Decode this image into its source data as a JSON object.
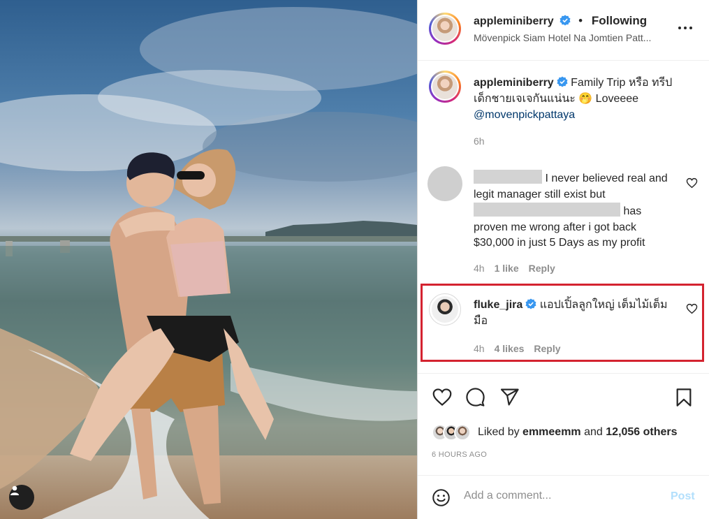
{
  "post": {
    "username": "appleminiberry",
    "follow_label": "Following",
    "location": "Movenpick Siam Hotel Na Jomtien Pattaya",
    "location_display": "Mövenpick Siam Hotel Na Jomtien Patt...",
    "caption_text": "Family Trip หรือ ทรีปเด็กชายเจเจกันแน่นะ 🤭 Loveeee",
    "caption_mention": "@movenpickpattaya",
    "caption_time": "6h"
  },
  "comments": [
    {
      "user_redacted": true,
      "text_a": "I never believed  real and legit manager still exist but",
      "text_b": "has proven me wrong after i got back $30,000 in just 5 Days as my profit",
      "time": "4h",
      "likes": "1 like",
      "reply": "Reply"
    },
    {
      "username": "fluke_jira",
      "text": "แอปเปิ้ลลูกใหญ่ เต็มไม้เต็มมือ",
      "time": "4h",
      "likes": "4 likes",
      "reply": "Reply",
      "highlighted": true
    }
  ],
  "likes": {
    "prefix": "Liked by",
    "user": "emmeemm",
    "and": "and",
    "others": "12,056 others"
  },
  "time_ago": "6 HOURS AGO",
  "comment_box": {
    "placeholder": "Add a comment...",
    "post_label": "Post"
  },
  "colors": {
    "verified": "#3897f0",
    "highlight_border": "#d42330",
    "mention": "#00376b",
    "post_disabled": "#b2dffc"
  }
}
